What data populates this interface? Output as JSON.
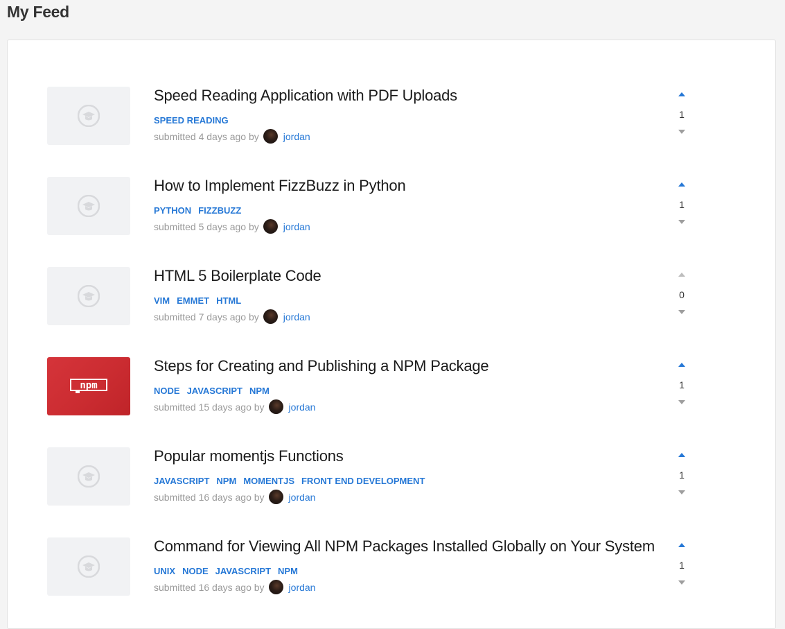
{
  "page": {
    "title": "My Feed"
  },
  "posts": [
    {
      "title": "Speed Reading Application with PDF Uploads",
      "tags": [
        "SPEED READING"
      ],
      "submitted": "submitted 4 days ago by",
      "author": "jordan",
      "votes": "1",
      "thumbnail": "placeholder-icon"
    },
    {
      "title": "How to Implement FizzBuzz in Python",
      "tags": [
        "PYTHON",
        "FIZZBUZZ"
      ],
      "submitted": "submitted 5 days ago by",
      "author": "jordan",
      "votes": "1",
      "thumbnail": "placeholder-icon"
    },
    {
      "title": "HTML 5 Boilerplate Code",
      "tags": [
        "VIM",
        "EMMET",
        "HTML"
      ],
      "submitted": "submitted 7 days ago by",
      "author": "jordan",
      "votes": "0",
      "thumbnail": "placeholder-icon"
    },
    {
      "title": "Steps for Creating and Publishing a NPM Package",
      "tags": [
        "NODE",
        "JAVASCRIPT",
        "NPM"
      ],
      "submitted": "submitted 15 days ago by",
      "author": "jordan",
      "votes": "1",
      "thumbnail": "npm-logo"
    },
    {
      "title": "Popular momentjs Functions",
      "tags": [
        "JAVASCRIPT",
        "NPM",
        "MOMENTJS",
        "FRONT END DEVELOPMENT"
      ],
      "submitted": "submitted 16 days ago by",
      "author": "jordan",
      "votes": "1",
      "thumbnail": "placeholder-icon"
    },
    {
      "title": "Command for Viewing All NPM Packages Installed Globally on Your System",
      "tags": [
        "UNIX",
        "NODE",
        "JAVASCRIPT",
        "NPM"
      ],
      "submitted": "submitted 16 days ago by",
      "author": "jordan",
      "votes": "1",
      "thumbnail": "placeholder-icon"
    }
  ],
  "logo_text": "npm",
  "colors": {
    "accent": "#2678d6",
    "npm_red": "#cb2c31",
    "placeholder_bg": "#f1f2f4"
  }
}
